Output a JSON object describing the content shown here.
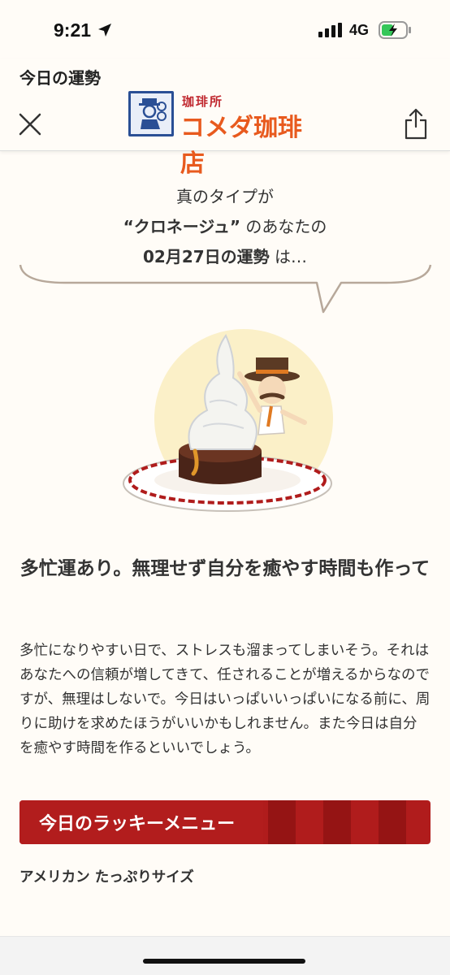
{
  "status_bar": {
    "time": "9:21",
    "network": "4G"
  },
  "header": {
    "title": "今日の運勢",
    "logo_sub": "珈琲所",
    "logo_main": "コメダ珈琲店"
  },
  "intro": {
    "line1": "真のタイプが",
    "line2_strong": "“クロネージュ”",
    "line2_rest": " のあなたの",
    "line3_strong": "02月27日の運勢",
    "line3_rest": " は…"
  },
  "fortune": {
    "title": "多忙運あり。無理せず自分を癒やす時間も作って",
    "body": "多忙になりやすい日で、ストレスも溜まってしまいそう。それはあなたへの信頼が増してきて、任されることが増えるからなのですが、無理はしないで。今日はいっぱいいっぱいになる前に、周りに助けを求めたほうがいいかもしれません。また今日は自分を癒やす時間を作るといいでしょう。"
  },
  "lucky_menu": {
    "title": "今日のラッキーメニュー",
    "item": "アメリカン たっぷりサイズ"
  },
  "colors": {
    "accent_red": "#b01c1c",
    "brand_orange": "#e85a1e",
    "brand_blue": "#2a4f95",
    "background": "#fffcf7"
  },
  "icons": [
    "location-arrow-icon",
    "signal-icon",
    "battery-charging-icon",
    "close-icon",
    "share-icon"
  ]
}
